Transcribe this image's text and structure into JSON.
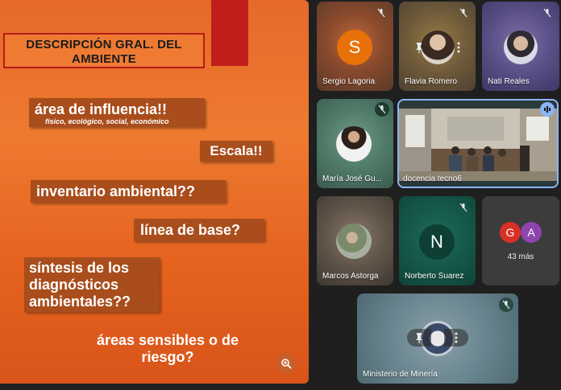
{
  "slide": {
    "title": "DESCRIPCIÓN GRAL. DEL AMBIENTE",
    "item1_title": "área de influencia!!",
    "item1_sub": "físico, ecológico, social, económico",
    "item2": "Escala!!",
    "item3": "inventario ambiental??",
    "item4": "línea de base?",
    "item5": "síntesis de los\ndiagnósticos\nambientales??",
    "item6": "áreas sensibles o de\nriesgo?"
  },
  "participants": [
    {
      "name": "Sergio Lagoria",
      "initial": "S"
    },
    {
      "name": "Flavia Romero"
    },
    {
      "name": "Nati Reales"
    },
    {
      "name": "María José Gu..."
    },
    {
      "name": "docencia tecno6"
    },
    {
      "name": "Marcos Astorga"
    },
    {
      "name": "Norberto Suarez",
      "initial": "N"
    },
    {
      "name": "Ministerio de Minería"
    }
  ],
  "more": {
    "label": "43 más",
    "initials": [
      "G",
      "A"
    ]
  },
  "colors": {
    "slide_orange": "#e8692a",
    "chip_brown": "#a94d1c",
    "sergio_avatar": "#e8710a",
    "g_avatar": "#d93025",
    "a_avatar": "#8e44ad"
  }
}
